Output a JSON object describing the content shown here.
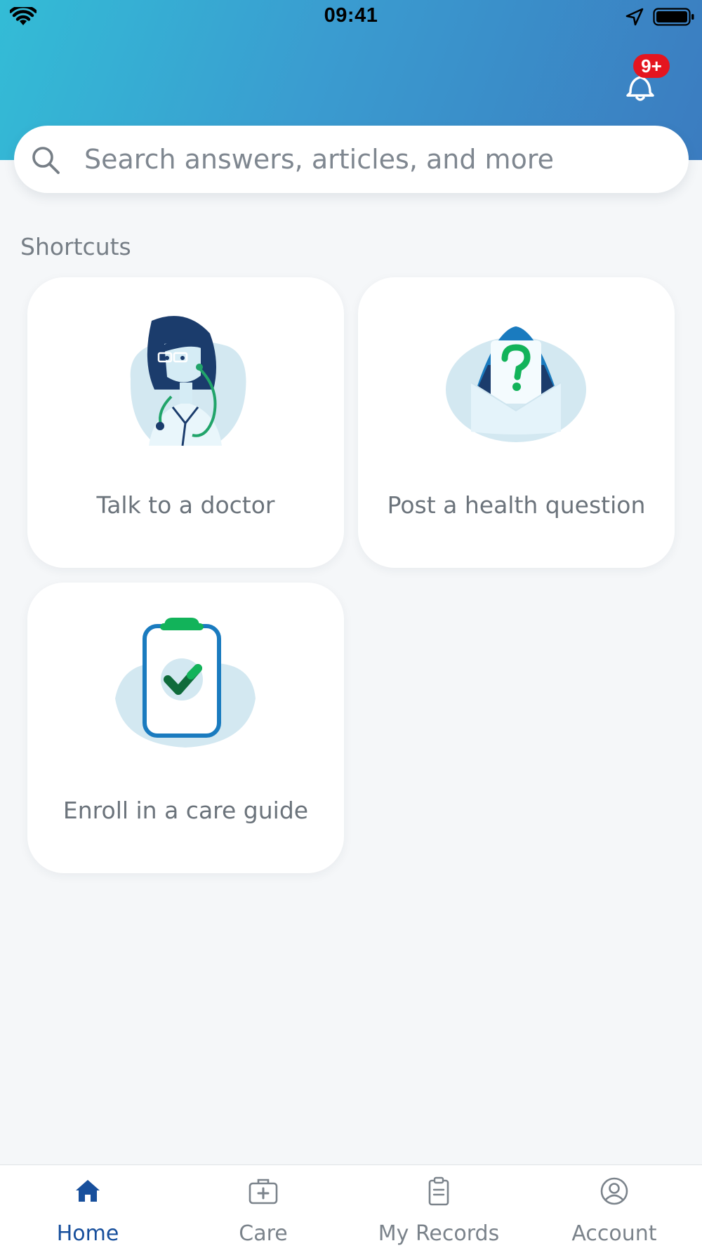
{
  "status_bar": {
    "time": "09:41",
    "icons": [
      "wifi-icon",
      "location-arrow-icon",
      "battery-icon"
    ]
  },
  "header": {
    "notification_badge": "9+",
    "gradient_colors": [
      "#33bcd6",
      "#3b7cc0"
    ]
  },
  "search": {
    "placeholder": "Search answers, articles, and more",
    "value": ""
  },
  "shortcuts": {
    "title": "Shortcuts",
    "items": [
      {
        "label": "Talk to a doctor",
        "icon": "doctor-illustration-icon"
      },
      {
        "label": "Post a health question",
        "icon": "question-envelope-illustration-icon"
      },
      {
        "label": "Enroll in a care guide",
        "icon": "clipboard-check-illustration-icon"
      }
    ]
  },
  "tabs": [
    {
      "label": "Home",
      "icon": "home-icon",
      "active": true
    },
    {
      "label": "Care",
      "icon": "medical-kit-icon",
      "active": false
    },
    {
      "label": "My Records",
      "icon": "clipboard-icon",
      "active": false
    },
    {
      "label": "Account",
      "icon": "user-circle-icon",
      "active": false
    }
  ],
  "colors": {
    "accent": "#174f9c",
    "badge": "#e4151f",
    "green": "#12b35a",
    "background": "#f5f7f9"
  }
}
